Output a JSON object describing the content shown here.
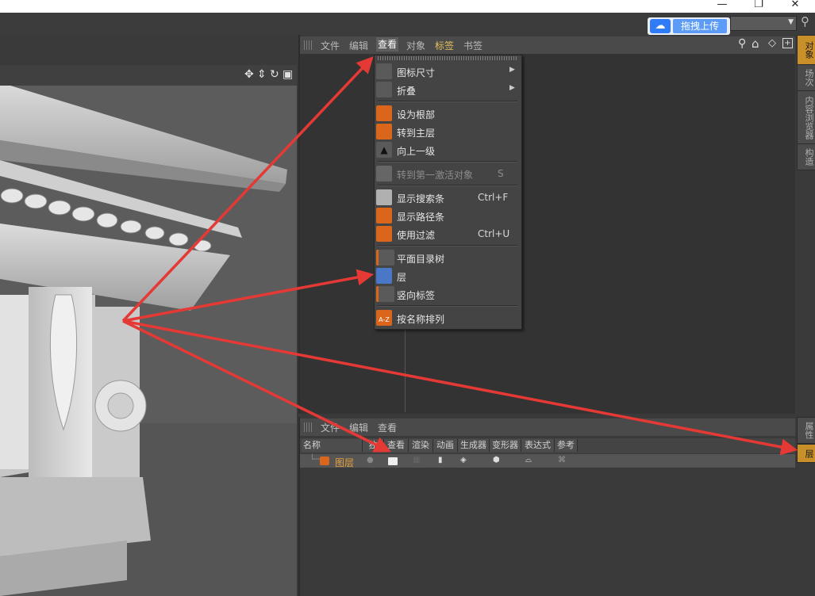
{
  "window": {
    "minimize": "—",
    "maximize": "❐",
    "close": "✕"
  },
  "baidu": {
    "upload_label": "拖拽上传",
    "logo": "☁"
  },
  "viewport": {
    "icons": [
      "move-icon",
      "vertical-move-icon",
      "rotate-icon",
      "maximize-icon"
    ]
  },
  "object_manager": {
    "menu": {
      "file": "文件",
      "edit": "编辑",
      "view": "查看",
      "objects": "对象",
      "tags": "标签",
      "bookmarks": "书签"
    }
  },
  "view_menu": {
    "items": [
      {
        "label": "图标尺寸",
        "submenu": true
      },
      {
        "label": "折叠",
        "submenu": true
      },
      {
        "label": "设为根部"
      },
      {
        "label": "转到主层"
      },
      {
        "label": "向上一级"
      },
      {
        "label": "转到第一激活对象",
        "shortcut": "S",
        "disabled": true
      },
      {
        "label": "显示搜索条",
        "shortcut": "Ctrl+F"
      },
      {
        "label": "显示路径条"
      },
      {
        "label": "使用过滤",
        "shortcut": "Ctrl+U"
      },
      {
        "label": "平面目录树"
      },
      {
        "label": "层"
      },
      {
        "label": "竖向标签"
      },
      {
        "label": "按名称排列"
      }
    ]
  },
  "side_tabs": {
    "objects": "对象",
    "takes": "场次",
    "content_browser": "内容浏览器",
    "structure": "构造",
    "attributes": "属性",
    "layers": "层"
  },
  "layer_manager": {
    "menu": {
      "file": "文件",
      "edit": "编辑",
      "view": "查看"
    },
    "columns": [
      "名称",
      "独",
      "查看",
      "渲染",
      "动画",
      "生成器",
      "变形器",
      "表达式",
      "参考"
    ],
    "row": {
      "name": "图层"
    }
  },
  "colors": {
    "accent": "#d9661a",
    "tag_yellow": "#e0c060",
    "active_tab": "#c9902a",
    "arrow": "#e53935"
  }
}
